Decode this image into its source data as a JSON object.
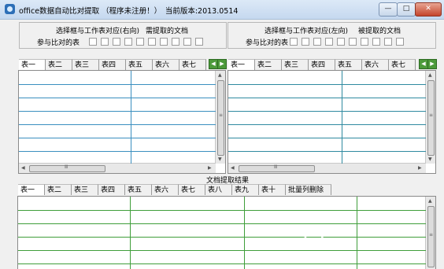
{
  "window": {
    "title": "office数据自动比对提取 （程序未注册！）　当前版本:2013.0514",
    "min_symbol": "—",
    "max_symbol": "□",
    "close_symbol": "✕"
  },
  "left_panel": {
    "select_label": "选择框与工作表对应(右向)",
    "doc_label": "需提取的文档",
    "compare_label": "参与比对的表",
    "checkbox_count": 10,
    "tabs": [
      "表一",
      "表二",
      "表三",
      "表四",
      "表五",
      "表六",
      "表七"
    ]
  },
  "right_panel": {
    "select_label": "选择框与工作表对应(左向)",
    "doc_label": "被提取的文档",
    "compare_label": "参与比对的表",
    "checkbox_count": 10,
    "tabs": [
      "表一",
      "表二",
      "表三",
      "表四",
      "表五",
      "表六",
      "表七"
    ]
  },
  "result": {
    "title": "文档提取结果",
    "tabs": [
      "表一",
      "表二",
      "表三",
      "表四",
      "表五",
      "表六",
      "表七",
      "表八",
      "表九",
      "表十",
      "批量列删除"
    ]
  },
  "scroll": {
    "arrow_up": "▲",
    "arrow_down": "▼",
    "arrow_left": "◀",
    "arrow_right": "▶",
    "thumb_grip": "≡",
    "thumb_grip_h": "Ⅲ"
  },
  "tab_nav": {
    "prev": "◀",
    "next": "▶"
  },
  "colors": {
    "left_grid_lines": "#3a8fbf",
    "right_grid_lines": "#2f8aa0",
    "result_grid_lines": "#3f9e3a"
  },
  "watermark": "TT"
}
